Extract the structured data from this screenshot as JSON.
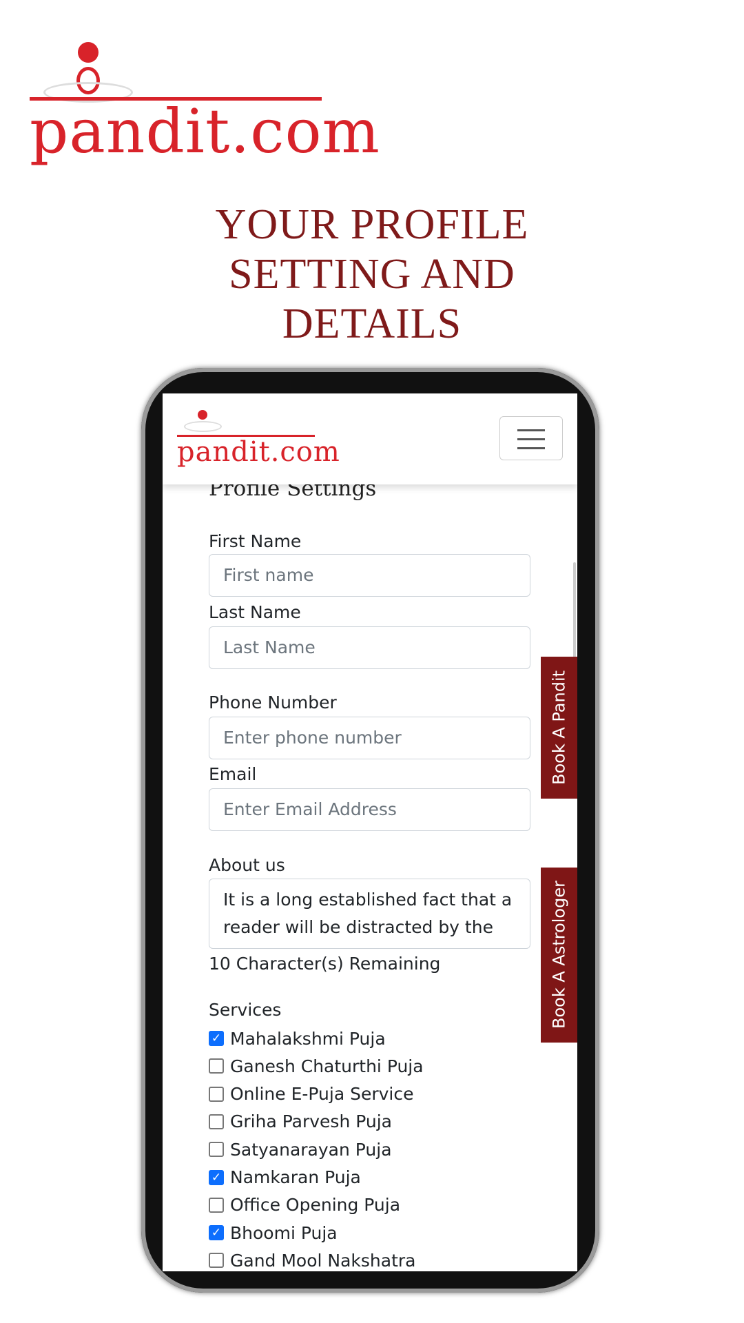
{
  "logo": {
    "text": "pandit.com"
  },
  "headline": {
    "line1": "YOUR PROFILE",
    "line2": "SETTING AND",
    "line3": "DETAILS"
  },
  "colors": {
    "brand_red": "#d8232a",
    "headline": "#7f1a1a",
    "side_tab": "#7f1616",
    "checkbox": "#0d6efd"
  },
  "app": {
    "logo_text": "pandit.com",
    "menu_icon": "hamburger-icon",
    "title": "Profile Settings",
    "fields": [
      {
        "label": "First Name",
        "placeholder": "First name"
      },
      {
        "label": "Last Name",
        "placeholder": "Last Name"
      },
      {
        "label": "Phone Number",
        "placeholder": "Enter phone number"
      },
      {
        "label": "Email",
        "placeholder": "Enter Email Address"
      }
    ],
    "about": {
      "label": "About us",
      "value": "It is a long established fact that a reader will be distracted by the",
      "remaining": "10 Character(s) Remaining"
    },
    "services": {
      "label": "Services",
      "items": [
        {
          "label": "Mahalakshmi Puja",
          "checked": true
        },
        {
          "label": "Ganesh Chaturthi Puja",
          "checked": false
        },
        {
          "label": "Online E-Puja Service",
          "checked": false
        },
        {
          "label": "Griha Parvesh Puja",
          "checked": false
        },
        {
          "label": "Satyanarayan Puja",
          "checked": false
        },
        {
          "label": "Namkaran Puja",
          "checked": true
        },
        {
          "label": "Office Opening Puja",
          "checked": false
        },
        {
          "label": "Bhoomi Puja",
          "checked": true
        },
        {
          "label": "Gand Mool Nakshatra",
          "checked": false
        }
      ]
    },
    "side_tabs": [
      "Book A Pandit",
      "Book A Astrologer"
    ]
  }
}
